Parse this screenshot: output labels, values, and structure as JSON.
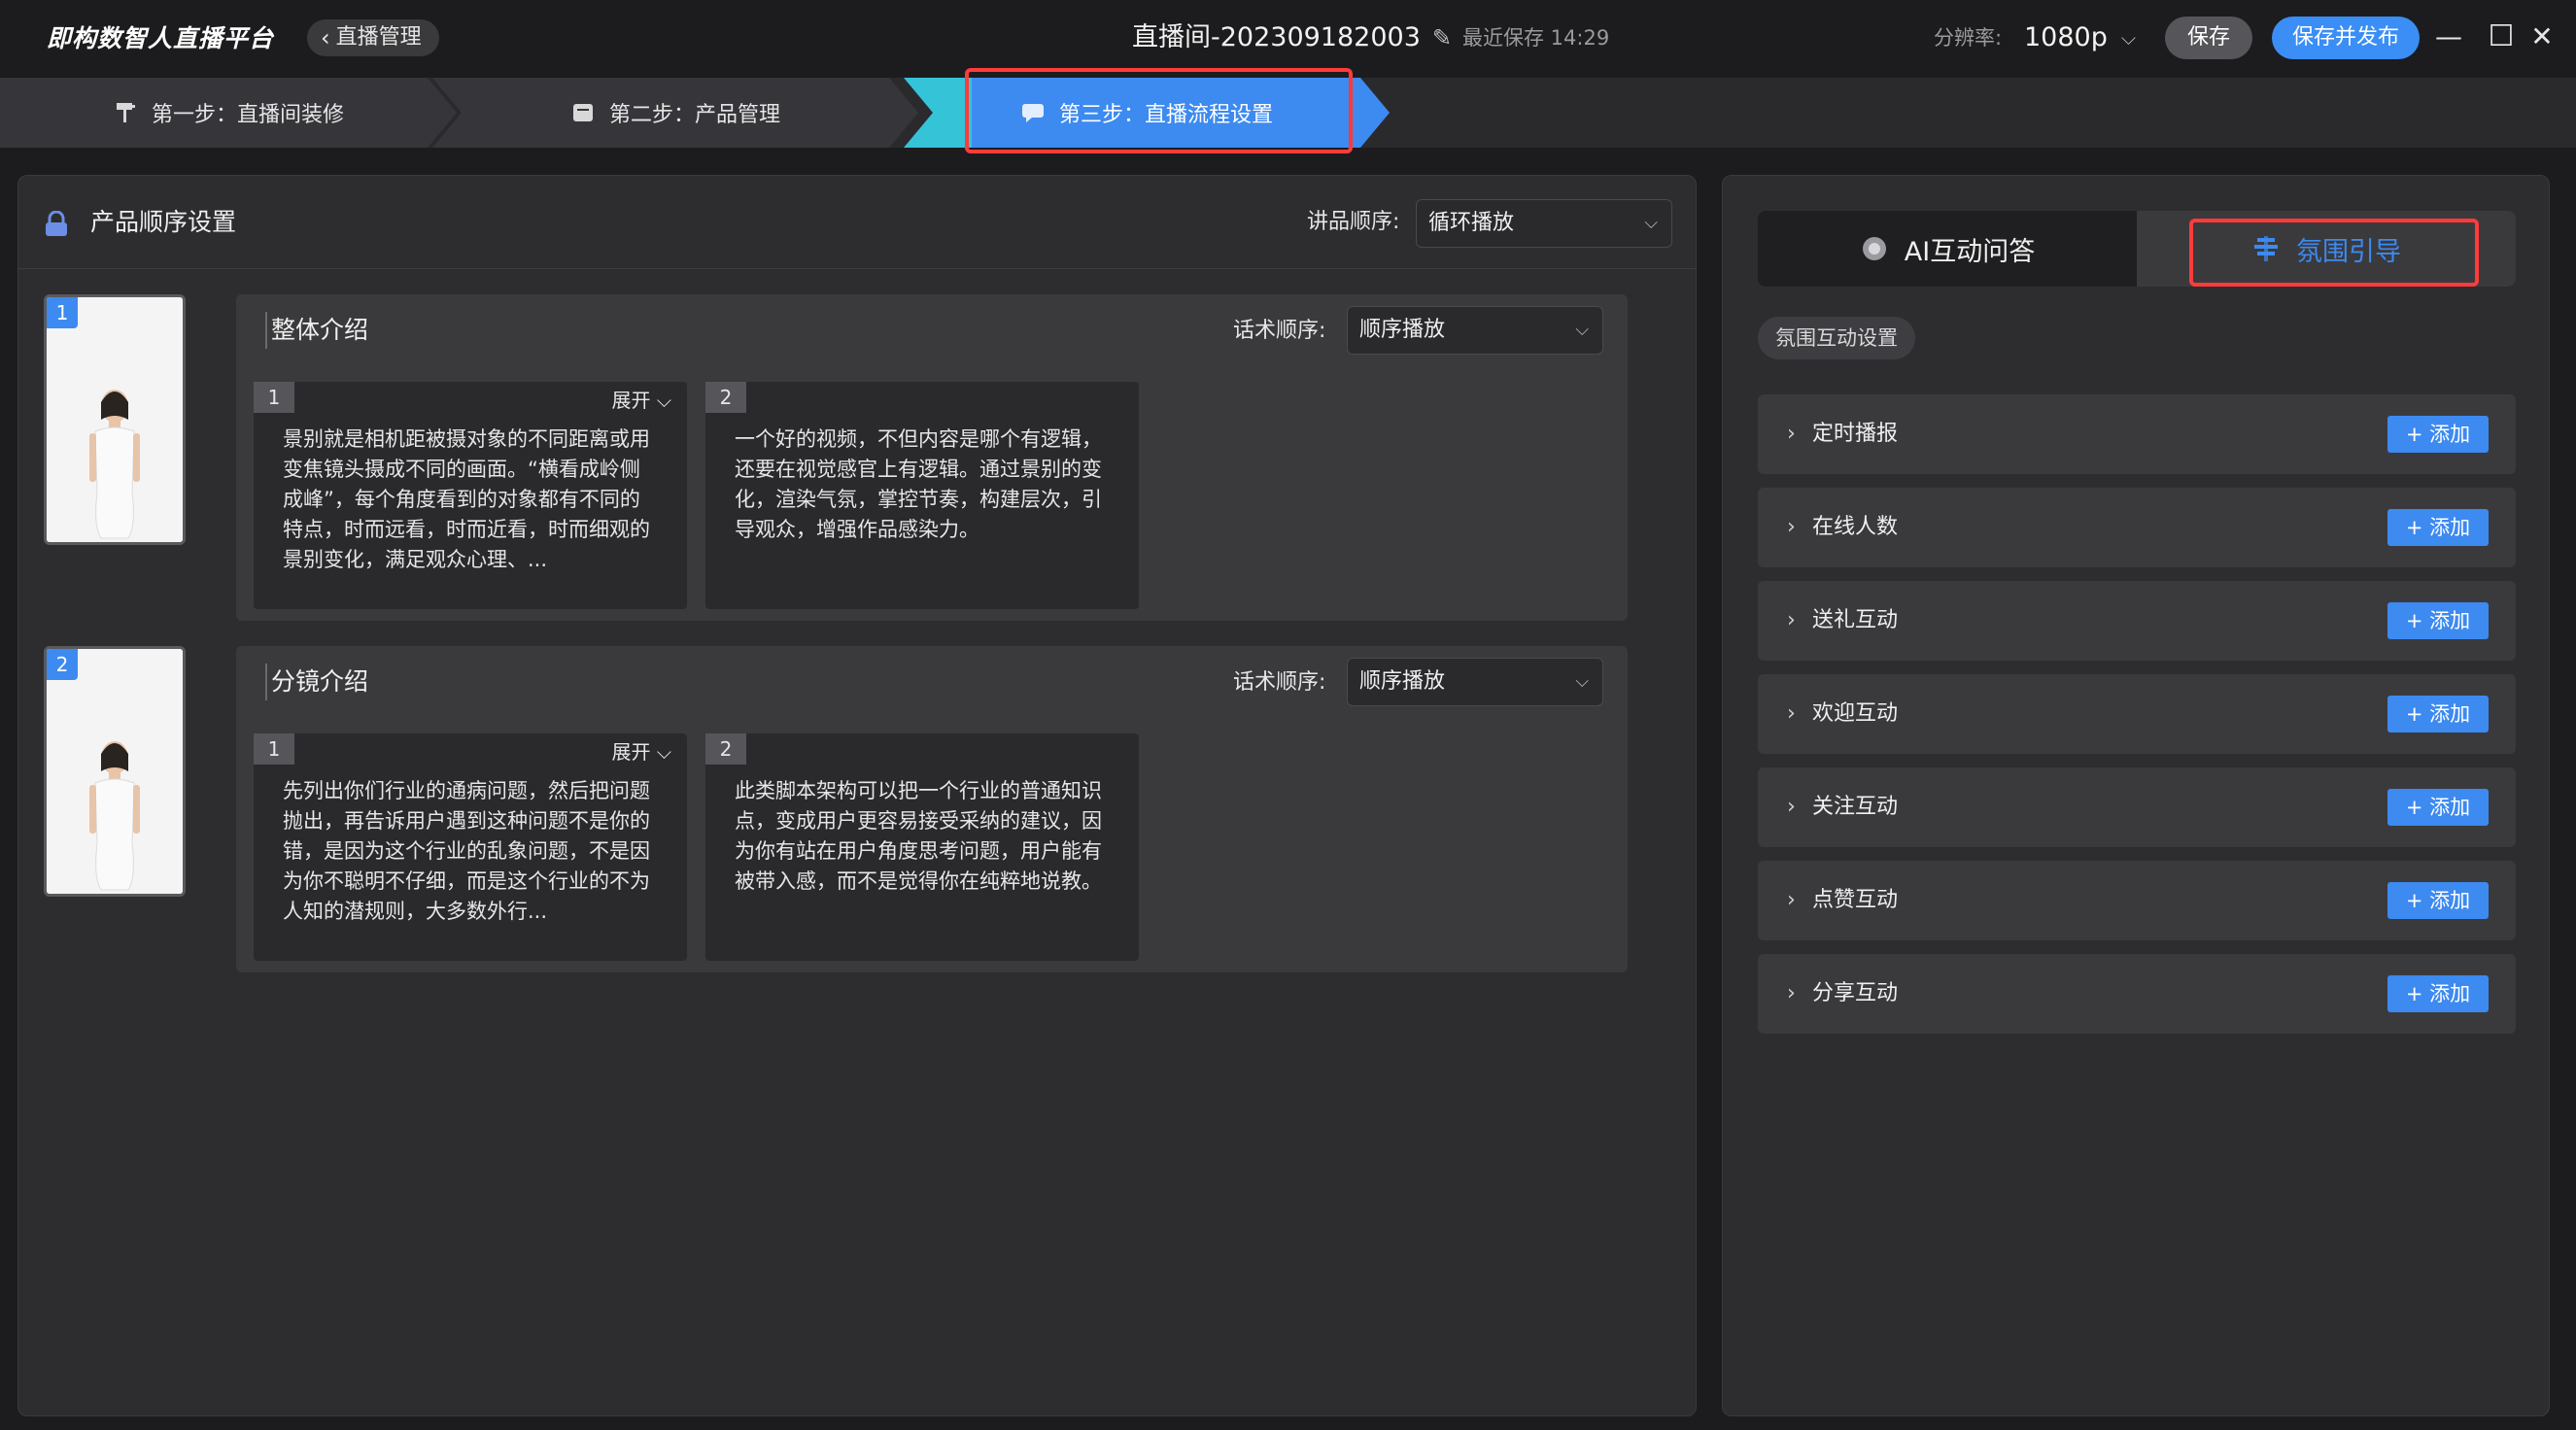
{
  "titlebar": {
    "brand": "即构数智人直播平台",
    "back_label": "直播管理",
    "room_title": "直播间-202309182003",
    "last_save": "最近保存 14:29",
    "resolution_label": "分辨率:",
    "resolution_value": "1080p",
    "save_label": "保存",
    "publish_label": "保存并发布",
    "minimize": "—",
    "maximize": "☐",
    "close": "✕"
  },
  "steps": [
    {
      "label": "第一步：直播间装修",
      "icon": "paint-roller-icon"
    },
    {
      "label": "第二步：产品管理",
      "icon": "box-icon"
    },
    {
      "label": "第三步：直播流程设置",
      "icon": "chat-icon"
    }
  ],
  "left": {
    "title": "产品顺序设置",
    "order_label": "讲品顺序:",
    "order_value": "循环播放",
    "products": [
      {
        "number": "1",
        "script_title": "整体介绍",
        "script_order_label": "话术顺序:",
        "script_order_value": "顺序播放",
        "cards": [
          {
            "number": "1",
            "expand": "展开",
            "text": "景别就是相机距被摄对象的不同距离或用变焦镜头摄成不同的画面。“横看成岭侧成峰”，每个角度看到的对象都有不同的特点，时而远看，时而近看，时而细观的景别变化，满足观众心理、..."
          },
          {
            "number": "2",
            "text": "一个好的视频，不但内容是哪个有逻辑，还要在视觉感官上有逻辑。通过景别的变化，渲染气氛，掌控节奏，构建层次，引导观众，增强作品感染力。"
          }
        ]
      },
      {
        "number": "2",
        "script_title": "分镜介绍",
        "script_order_label": "话术顺序:",
        "script_order_value": "顺序播放",
        "cards": [
          {
            "number": "1",
            "expand": "展开",
            "text": "先列出你们行业的通病问题，然后把问题抛出，再告诉用户遇到这种问题不是你的错，是因为这个行业的乱象问题，不是因为你不聪明不仔细，而是这个行业的不为人知的潜规则，大多数外行..."
          },
          {
            "number": "2",
            "text": "此类脚本架构可以把一个行业的普通知识点，变成用户更容易接受采纳的建议，因为你有站在用户角度思考问题，用户能有被带入感，而不是觉得你在纯粹地说教。"
          }
        ]
      }
    ]
  },
  "right": {
    "tab_ai": "AI互动问答",
    "tab_atmosphere": "氛围引导",
    "settings_chip": "氛围互动设置",
    "add_label": "+ 添加",
    "rows": [
      {
        "label": "定时播报"
      },
      {
        "label": "在线人数"
      },
      {
        "label": "送礼互动"
      },
      {
        "label": "欢迎互动"
      },
      {
        "label": "关注互动"
      },
      {
        "label": "点赞互动"
      },
      {
        "label": "分享互动"
      }
    ]
  },
  "colors": {
    "accent": "#3d8af0",
    "highlight": "#ff3b3b",
    "background": "#1c1c1e",
    "panel": "#2d2d30"
  }
}
